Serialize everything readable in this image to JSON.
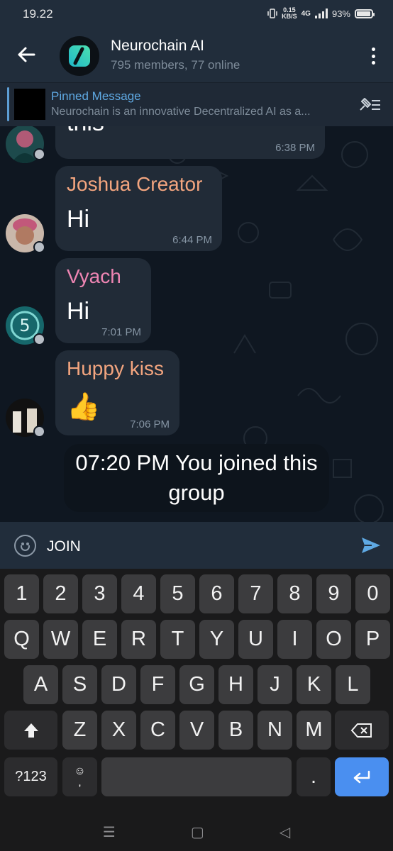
{
  "status_bar": {
    "time": "19.22",
    "net_speed": "0.15",
    "net_unit": "KB/S",
    "network": "4G",
    "battery": "93%",
    "battery_level": 0.93
  },
  "header": {
    "title": "Neurochain AI",
    "subtitle": "795 members, 77 online"
  },
  "pinned": {
    "title": "Pinned Message",
    "text": "Neurochain is an innovative Decentralized AI as a..."
  },
  "messages": [
    {
      "text": "this",
      "time": "6:38 PM"
    },
    {
      "sender": "Joshua Creator",
      "sender_color": "#f3a57f",
      "text": "Hi",
      "time": "6:44 PM"
    },
    {
      "sender": "Vyach",
      "sender_color": "#ee85b3",
      "text": "Hi",
      "time": "7:01 PM"
    },
    {
      "sender": "Huppy kiss",
      "sender_color": "#f3a57f",
      "text": "👍",
      "time": "7:06 PM"
    }
  ],
  "system_message": {
    "line1": "07:20 PM You joined this",
    "line2": "group"
  },
  "composer": {
    "value": "JOIN",
    "emoji_icon": "smile-icon",
    "send_icon": "send-icon"
  },
  "keyboard": {
    "row_numbers": [
      "1",
      "2",
      "3",
      "4",
      "5",
      "6",
      "7",
      "8",
      "9",
      "0"
    ],
    "row1": [
      "Q",
      "W",
      "E",
      "R",
      "T",
      "Y",
      "U",
      "I",
      "O",
      "P"
    ],
    "row2": [
      "A",
      "S",
      "D",
      "F",
      "G",
      "H",
      "J",
      "K",
      "L"
    ],
    "row3": [
      "Z",
      "X",
      "C",
      "V",
      "B",
      "N",
      "M"
    ],
    "symbols_label": "?123",
    "comma_label": ",",
    "period_label": "."
  }
}
